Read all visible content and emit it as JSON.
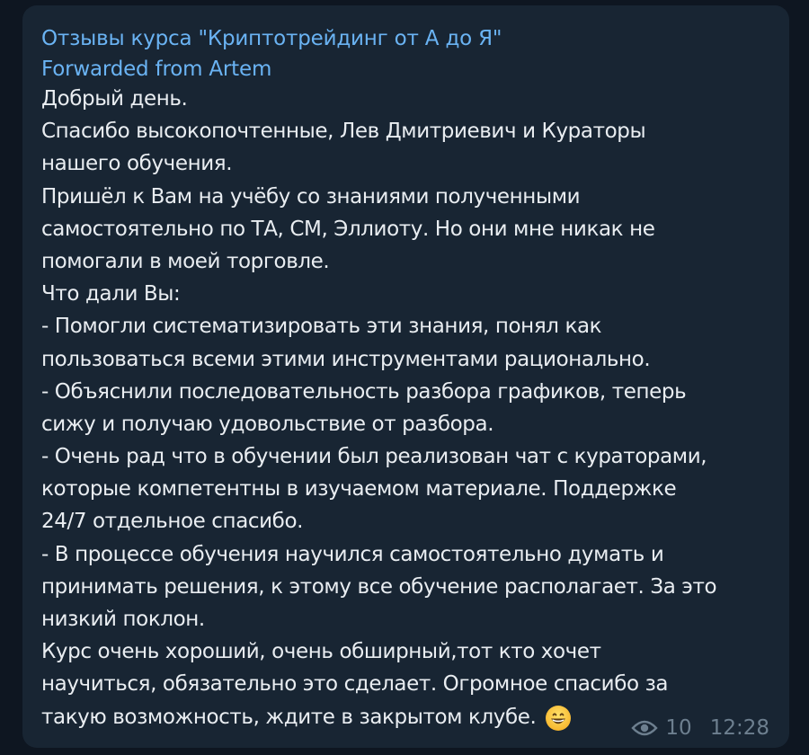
{
  "message": {
    "channel_name": "Отзывы курса \"Криптотрейдинг от А до Я\"",
    "forwarded_from": "Forwarded from Artem",
    "lines": [
      "Добрый день.",
      "Спасибо высокопочтенные, Лев Дмитриевич и Кураторы",
      "нашего обучения.",
      "Пришёл к Вам на учёбу со знаниями полученными",
      "самостоятельно по ТА, СМ, Эллиоту. Но они мне никак не",
      "помогали в моей торговле.",
      "Что дали Вы:",
      "- Помогли систематизировать эти знания, понял как",
      "пользоваться всеми этими инструментами рационально.",
      "- Объяснили последовательность разбора графиков, теперь",
      "сижу и получаю удовольствие от разбора.",
      "- Очень рад что в обучении был реализован чат с кураторами,",
      "которые  компетентны в изучаемом материале.  Поддержке",
      "24/7 отдельное спасибо.",
      "- В процессе обучения научился самостоятельно думать и",
      "принимать решения, к этому все обучение располагает. За это",
      "низкий поклон.",
      "Курс очень хороший, очень обширный,тот кто хочет",
      "научиться, обязательно это сделает. Огромное спасибо за"
    ],
    "last_line": "такую возможность, ждите в закрытом клубе.",
    "emoji": "grinning-face-emoji",
    "views": "10",
    "time": "12:28"
  },
  "colors": {
    "background": "#0e1621",
    "bubble": "#182533",
    "link": "#6ab3f3",
    "text": "#e9edf1",
    "meta": "#6d7f8f"
  }
}
